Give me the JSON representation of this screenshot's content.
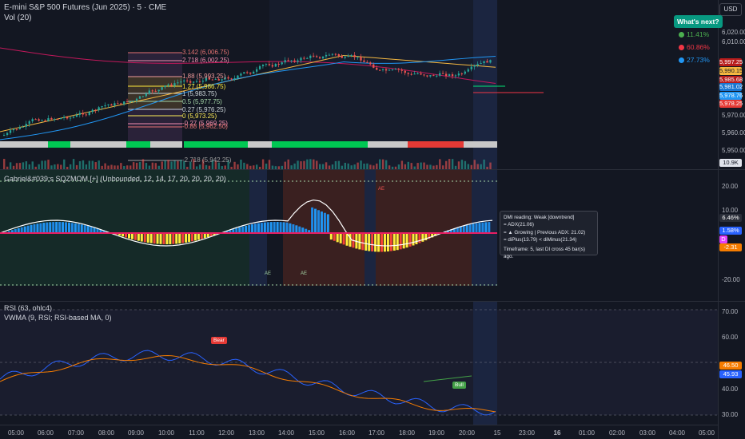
{
  "chart": {
    "title": "E-mini S&P 500 Futures (Jun 2025) · 5 · CME",
    "volume_label": "Vol (20)",
    "currency_button": "USD",
    "price_ticks": [
      "6,020.00",
      "6,010.00",
      "5,970.00",
      "5,960.00",
      "5,950.00"
    ],
    "fib_levels": [
      "3.142 (6,006.75)",
      "2.718 (6,002.25)",
      "1.88 (5,993.25)",
      "1.27 (5,986.75)",
      "1 (5,983.75)",
      "0.5 (5,977.75)",
      "0.27 (5,976.25)",
      "0 (5,973.25)",
      "-0.27 (5,969.25)",
      "-0.88 (5,962.50)",
      "-2.718 (5,942.25)"
    ],
    "price_tags": [
      {
        "label": "5,997.25",
        "color": "#b71c1c"
      },
      {
        "label": "5,990.15",
        "color": "#f5b841"
      },
      {
        "label": "5,985.68",
        "color": "#b71c1c"
      },
      {
        "label": "5,981.02",
        "color": "#1976d2"
      },
      {
        "label": "5,978.76",
        "color": "#2196f3"
      },
      {
        "label": "5,978.25",
        "color": "#e53935"
      }
    ],
    "volume_tag": "10.9K"
  },
  "whats_next": {
    "title": "What's next?",
    "items": [
      {
        "label": "11.41%",
        "color": "#4caf50"
      },
      {
        "label": "60.86%",
        "color": "#f23645"
      },
      {
        "label": "27.73%",
        "color": "#2196f3"
      }
    ]
  },
  "sqzmom": {
    "title": "Gabriel&#039;s SQZMOM [+] (Unbounded, 12, 14, 17, 20, 20, 20, 20)",
    "axis_ticks": [
      "20.00",
      "10.00",
      "-20.00"
    ],
    "tags": [
      {
        "label": "6.46%",
        "color": "#2a2e39"
      },
      {
        "label": "1.58%",
        "color": "#2962ff"
      },
      {
        "label": "D",
        "color": "#e040fb"
      },
      {
        "label": "-2.31",
        "color": "#f57c00"
      }
    ],
    "markers": [
      "AE",
      "AE",
      "AE",
      "AE",
      "AE",
      "AE",
      "AE"
    ],
    "dmi_tooltip": {
      "line1": "DMI reading: Weak [downtrend]",
      "line2": "= ADX(21.06)",
      "line3": "= ▲ Growing | Previous ADX: 21.02)",
      "line4": "= diPlus(13.79) < diMinus(21.34)",
      "line5": "Timeframe: 5, last DI cross 45 bar(s) ago."
    }
  },
  "rsi": {
    "title": "RSI (63, ohlc4)",
    "vwma_title": "VWMA (9, RSI; RSI-based MA, 0)",
    "axis_ticks": [
      "70.00",
      "60.00",
      "40.00",
      "30.00"
    ],
    "tags": [
      {
        "label": "46.50",
        "color": "#f57c00"
      },
      {
        "label": "45.93",
        "color": "#2962ff"
      }
    ],
    "bear_label": "Bear",
    "bull_label": "Bull"
  },
  "time_axis": [
    "05:00",
    "06:00",
    "07:00",
    "08:00",
    "09:00",
    "10:00",
    "11:00",
    "12:00",
    "13:00",
    "14:00",
    "15:00",
    "16:00",
    "17:00",
    "18:00",
    "19:00",
    "20:00",
    "15",
    "23:00",
    "16",
    "01:00",
    "02:00",
    "03:00",
    "04:00",
    "05:00"
  ]
}
